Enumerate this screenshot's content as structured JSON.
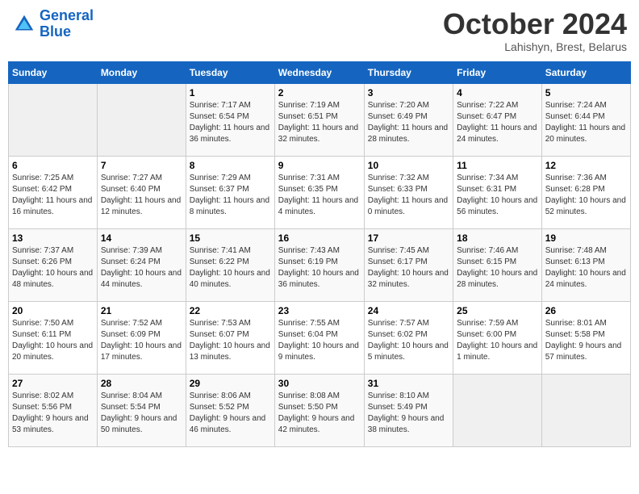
{
  "header": {
    "logo_line1": "General",
    "logo_line2": "Blue",
    "month": "October 2024",
    "location": "Lahishyn, Brest, Belarus"
  },
  "weekdays": [
    "Sunday",
    "Monday",
    "Tuesday",
    "Wednesday",
    "Thursday",
    "Friday",
    "Saturday"
  ],
  "weeks": [
    [
      {
        "day": "",
        "empty": true
      },
      {
        "day": "",
        "empty": true
      },
      {
        "day": "1",
        "sunrise": "7:17 AM",
        "sunset": "6:54 PM",
        "daylight": "11 hours and 36 minutes."
      },
      {
        "day": "2",
        "sunrise": "7:19 AM",
        "sunset": "6:51 PM",
        "daylight": "11 hours and 32 minutes."
      },
      {
        "day": "3",
        "sunrise": "7:20 AM",
        "sunset": "6:49 PM",
        "daylight": "11 hours and 28 minutes."
      },
      {
        "day": "4",
        "sunrise": "7:22 AM",
        "sunset": "6:47 PM",
        "daylight": "11 hours and 24 minutes."
      },
      {
        "day": "5",
        "sunrise": "7:24 AM",
        "sunset": "6:44 PM",
        "daylight": "11 hours and 20 minutes."
      }
    ],
    [
      {
        "day": "6",
        "sunrise": "7:25 AM",
        "sunset": "6:42 PM",
        "daylight": "11 hours and 16 minutes."
      },
      {
        "day": "7",
        "sunrise": "7:27 AM",
        "sunset": "6:40 PM",
        "daylight": "11 hours and 12 minutes."
      },
      {
        "day": "8",
        "sunrise": "7:29 AM",
        "sunset": "6:37 PM",
        "daylight": "11 hours and 8 minutes."
      },
      {
        "day": "9",
        "sunrise": "7:31 AM",
        "sunset": "6:35 PM",
        "daylight": "11 hours and 4 minutes."
      },
      {
        "day": "10",
        "sunrise": "7:32 AM",
        "sunset": "6:33 PM",
        "daylight": "11 hours and 0 minutes."
      },
      {
        "day": "11",
        "sunrise": "7:34 AM",
        "sunset": "6:31 PM",
        "daylight": "10 hours and 56 minutes."
      },
      {
        "day": "12",
        "sunrise": "7:36 AM",
        "sunset": "6:28 PM",
        "daylight": "10 hours and 52 minutes."
      }
    ],
    [
      {
        "day": "13",
        "sunrise": "7:37 AM",
        "sunset": "6:26 PM",
        "daylight": "10 hours and 48 minutes."
      },
      {
        "day": "14",
        "sunrise": "7:39 AM",
        "sunset": "6:24 PM",
        "daylight": "10 hours and 44 minutes."
      },
      {
        "day": "15",
        "sunrise": "7:41 AM",
        "sunset": "6:22 PM",
        "daylight": "10 hours and 40 minutes."
      },
      {
        "day": "16",
        "sunrise": "7:43 AM",
        "sunset": "6:19 PM",
        "daylight": "10 hours and 36 minutes."
      },
      {
        "day": "17",
        "sunrise": "7:45 AM",
        "sunset": "6:17 PM",
        "daylight": "10 hours and 32 minutes."
      },
      {
        "day": "18",
        "sunrise": "7:46 AM",
        "sunset": "6:15 PM",
        "daylight": "10 hours and 28 minutes."
      },
      {
        "day": "19",
        "sunrise": "7:48 AM",
        "sunset": "6:13 PM",
        "daylight": "10 hours and 24 minutes."
      }
    ],
    [
      {
        "day": "20",
        "sunrise": "7:50 AM",
        "sunset": "6:11 PM",
        "daylight": "10 hours and 20 minutes."
      },
      {
        "day": "21",
        "sunrise": "7:52 AM",
        "sunset": "6:09 PM",
        "daylight": "10 hours and 17 minutes."
      },
      {
        "day": "22",
        "sunrise": "7:53 AM",
        "sunset": "6:07 PM",
        "daylight": "10 hours and 13 minutes."
      },
      {
        "day": "23",
        "sunrise": "7:55 AM",
        "sunset": "6:04 PM",
        "daylight": "10 hours and 9 minutes."
      },
      {
        "day": "24",
        "sunrise": "7:57 AM",
        "sunset": "6:02 PM",
        "daylight": "10 hours and 5 minutes."
      },
      {
        "day": "25",
        "sunrise": "7:59 AM",
        "sunset": "6:00 PM",
        "daylight": "10 hours and 1 minute."
      },
      {
        "day": "26",
        "sunrise": "8:01 AM",
        "sunset": "5:58 PM",
        "daylight": "9 hours and 57 minutes."
      }
    ],
    [
      {
        "day": "27",
        "sunrise": "8:02 AM",
        "sunset": "5:56 PM",
        "daylight": "9 hours and 53 minutes."
      },
      {
        "day": "28",
        "sunrise": "8:04 AM",
        "sunset": "5:54 PM",
        "daylight": "9 hours and 50 minutes."
      },
      {
        "day": "29",
        "sunrise": "8:06 AM",
        "sunset": "5:52 PM",
        "daylight": "9 hours and 46 minutes."
      },
      {
        "day": "30",
        "sunrise": "8:08 AM",
        "sunset": "5:50 PM",
        "daylight": "9 hours and 42 minutes."
      },
      {
        "day": "31",
        "sunrise": "8:10 AM",
        "sunset": "5:49 PM",
        "daylight": "9 hours and 38 minutes."
      },
      {
        "day": "",
        "empty": true
      },
      {
        "day": "",
        "empty": true
      }
    ]
  ],
  "labels": {
    "sunrise": "Sunrise:",
    "sunset": "Sunset:",
    "daylight": "Daylight:"
  }
}
